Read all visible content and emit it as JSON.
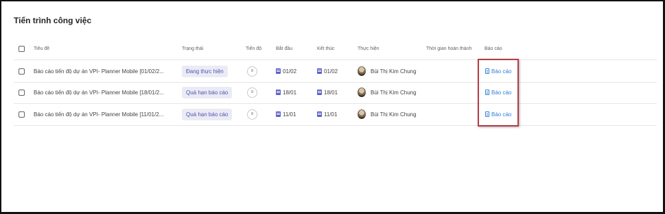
{
  "page": {
    "title": "Tiến trình công việc"
  },
  "table": {
    "headers": {
      "title": "Tiêu đề",
      "status": "Trạng thái",
      "progress": "Tiến độ",
      "start": "Bắt đầu",
      "end": "Kết thúc",
      "owner": "Thực hiện",
      "completed": "Thời gian hoàn thành",
      "report": "Báo cáo"
    },
    "rows": [
      {
        "title": "Báo cáo tiến độ dự án VPI- Planner Mobile [01/02/2...",
        "status": "Đang thực hiện",
        "progress": "0",
        "start": "01/02",
        "end": "01/02",
        "owner": "Bùi Thị Kim Chung",
        "completed": "",
        "report": "Báo cáo"
      },
      {
        "title": "Báo cáo tiến độ dự án VPI- Planner Mobile [18/01/2...",
        "status": "Quá hạn báo cáo",
        "progress": "0",
        "start": "18/01",
        "end": "18/01",
        "owner": "Bùi Thị Kim Chung",
        "completed": "",
        "report": "Báo cáo"
      },
      {
        "title": "Báo cáo tiến độ dự án VPI- Planner Mobile [11/01/2...",
        "status": "Quá hạn báo cáo",
        "progress": "0",
        "start": "11/01",
        "end": "11/01",
        "owner": "Bùi Thị Kim Chung",
        "completed": "",
        "report": "Báo cáo"
      }
    ]
  },
  "colors": {
    "accent": "#5b5fc7",
    "status_pill_bg": "#ebebf5",
    "status_pill_text": "#4f52b2",
    "link": "#2f7fd6",
    "highlight_border": "#b73b46"
  },
  "icons": {
    "date": "calendar-icon",
    "report": "document-icon",
    "owner": "avatar"
  }
}
